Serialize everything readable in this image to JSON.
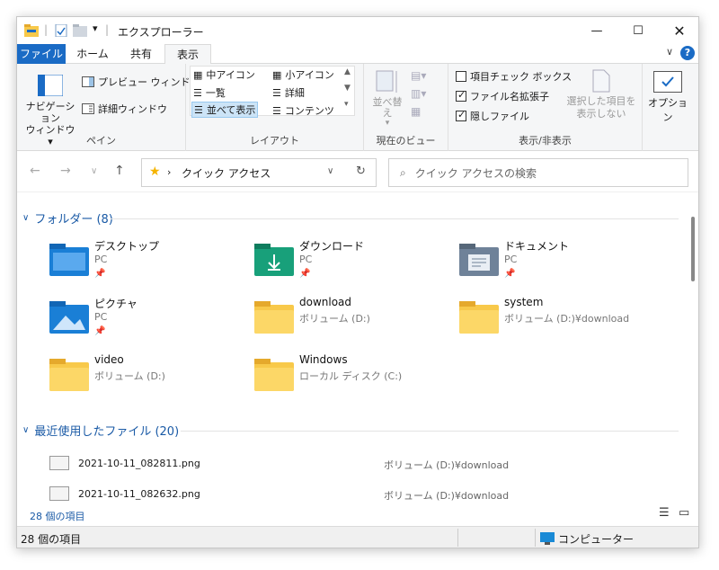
{
  "window": {
    "title": "エクスプローラー"
  },
  "tabs": {
    "file": "ファイル",
    "home": "ホーム",
    "share": "共有",
    "view": "表示"
  },
  "ribbon": {
    "pane": {
      "nav_label_1": "ナビゲーション",
      "nav_label_2": "ウィンドウ",
      "preview": "プレビュー ウィンドウ",
      "details": "詳細ウィンドウ",
      "group": "ペイン"
    },
    "layout": {
      "medium_icons": "中アイコン",
      "small_icons": "小アイコン",
      "list": "一覧",
      "details": "詳細",
      "tiles": "並べて表示",
      "content": "コンテンツ",
      "group": "レイアウト"
    },
    "current_view": {
      "sort": "並べ替え",
      "group": "現在のビュー"
    },
    "show_hide": {
      "item_checkboxes": "項目チェック ボックス",
      "file_ext": "ファイル名拡張子",
      "hidden_files": "隠しファイル",
      "hide_selected_1": "選択した項目を",
      "hide_selected_2": "表示しない",
      "group": "表示/非表示",
      "item_checkboxes_checked": false,
      "file_ext_checked": true,
      "hidden_files_checked": true
    },
    "options": "オプション"
  },
  "address": {
    "path": "クイック アクセス",
    "search_placeholder": "クイック アクセスの検索"
  },
  "folders_section": {
    "title": "フォルダー (8)"
  },
  "folders": [
    {
      "name": "デスクトップ",
      "sub": "PC"
    },
    {
      "name": "ダウンロード",
      "sub": "PC"
    },
    {
      "name": "ドキュメント",
      "sub": "PC"
    },
    {
      "name": "ピクチャ",
      "sub": "PC"
    },
    {
      "name": "download",
      "sub": "ボリューム (D:)"
    },
    {
      "name": "system",
      "sub": "ボリューム (D:)¥download"
    },
    {
      "name": "video",
      "sub": "ボリューム (D:)"
    },
    {
      "name": "Windows",
      "sub": "ローカル ディスク (C:)"
    }
  ],
  "recent_section": {
    "title": "最近使用したファイル (20)"
  },
  "recent": [
    {
      "name": "2021-10-11_082811.png",
      "location": "ボリューム (D:)¥download"
    },
    {
      "name": "2021-10-11_082632.png",
      "location": "ボリューム (D:)¥download"
    }
  ],
  "status": {
    "inner_count": "28 個の項目",
    "count": "28 個の項目",
    "computer": "コンピューター"
  },
  "colors": {
    "accent": "#1a6bc5",
    "folder": "#f8c94a",
    "link": "#1a5aa6"
  }
}
